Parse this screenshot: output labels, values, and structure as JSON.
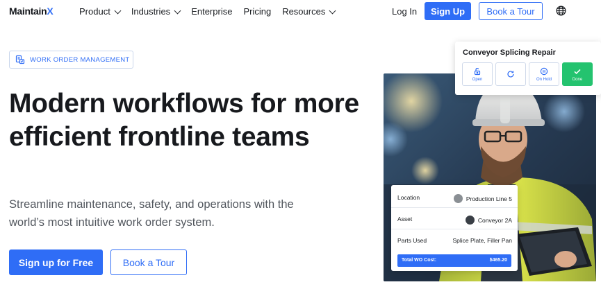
{
  "nav": {
    "logo_main": "Maintain",
    "logo_x": "X",
    "items": [
      {
        "label": "Product",
        "has_dropdown": true
      },
      {
        "label": "Industries",
        "has_dropdown": true
      },
      {
        "label": "Enterprise",
        "has_dropdown": false
      },
      {
        "label": "Pricing",
        "has_dropdown": false
      },
      {
        "label": "Resources",
        "has_dropdown": true
      }
    ],
    "login": "Log In",
    "signup": "Sign Up",
    "book_tour": "Book a Tour",
    "language_icon": "globe-icon"
  },
  "hero": {
    "badge": "WORK ORDER MANAGEMENT",
    "badge_icon": "work-order-icon",
    "headline": "Modern workflows for more efficient frontline teams",
    "subheading": "Streamline maintenance, safety, and operations with the world’s most intuitive work order system.",
    "cta_primary": "Sign up for Free",
    "cta_secondary": "Book a Tour"
  },
  "status_card": {
    "title": "Conveyor Splicing Repair",
    "buttons": [
      {
        "label": "Open",
        "icon": "unlock-icon"
      },
      {
        "label": "",
        "icon": "refresh-icon"
      },
      {
        "label": "On Hold",
        "icon": "pause-icon"
      },
      {
        "label": "Done",
        "icon": "check-icon"
      }
    ]
  },
  "detail_card": {
    "rows": [
      {
        "label": "Location",
        "value": "Production Line 5"
      },
      {
        "label": "Asset",
        "value": "Conveyor 2A"
      },
      {
        "label": "Parts Used",
        "value": "Splice Plate, Filler Pan"
      }
    ],
    "total_label": "Total WO Cost:",
    "total_value": "$465.20"
  },
  "colors": {
    "brand_blue": "#2f6df6",
    "done_green": "#24c36f",
    "text_dark": "#17191d",
    "text_muted": "#52575e"
  }
}
